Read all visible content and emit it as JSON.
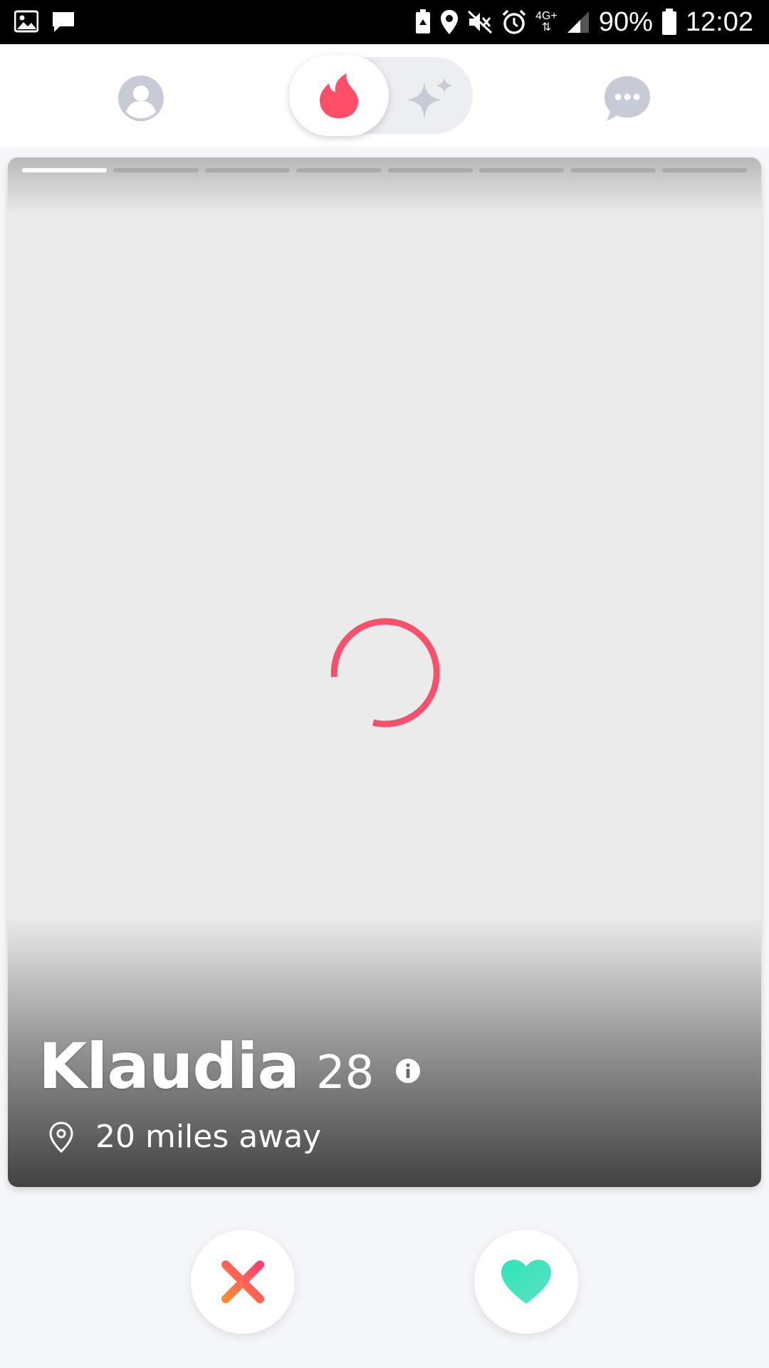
{
  "status_bar": {
    "battery_percent": "90%",
    "time": "12:02",
    "network_label": "4G+",
    "icons": [
      "gallery-icon",
      "message-icon",
      "battery-saver-icon",
      "location-icon",
      "mute-icon",
      "alarm-icon",
      "signal-icon",
      "battery-icon"
    ]
  },
  "top_nav": {
    "icons": [
      "profile-icon",
      "tinder-flame-icon",
      "sparkle-icon",
      "chat-bubble-icon"
    ],
    "active_tab": "flame",
    "colors": {
      "brand": "#fd5068",
      "inactive": "#c7cbd6"
    }
  },
  "card": {
    "photo_count": 8,
    "active_photo_index": 0,
    "loading": true,
    "name": "Klaudia",
    "age": "28",
    "distance": "20 miles away",
    "colors": {
      "spinner": "#f7506a",
      "placeholder": "#ecebeb"
    }
  },
  "actions": {
    "nope_icon": "x-icon",
    "like_icon": "heart-icon",
    "colors": {
      "nope_start": "#ff4f6a",
      "nope_end": "#ff7a3d",
      "like": "#3ee3b6"
    }
  }
}
